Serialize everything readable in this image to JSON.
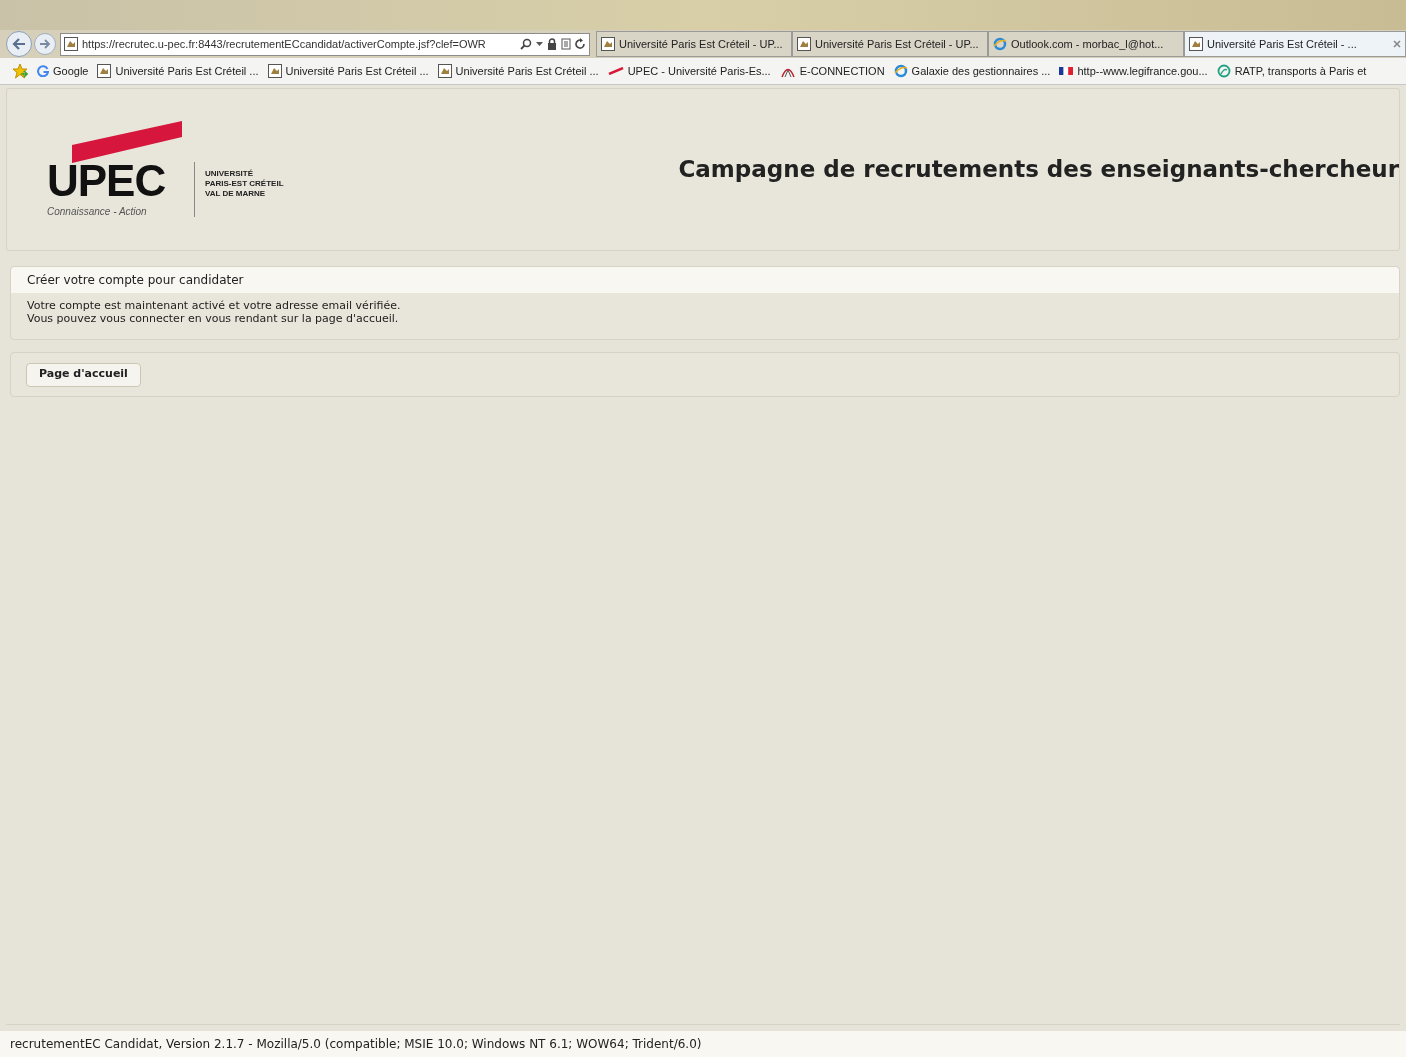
{
  "browser": {
    "url": "https://recrutec.u-pec.fr:8443/recrutementECcandidat/activerCompte.jsf?clef=OWR",
    "tabs": [
      {
        "label": "Université Paris Est Créteil - UP...",
        "kind": "site",
        "selected": false
      },
      {
        "label": "Université Paris Est Créteil - UP...",
        "kind": "site",
        "selected": false
      },
      {
        "label": "Outlook.com - morbac_l@hot...",
        "kind": "ie",
        "selected": false
      },
      {
        "label": "Université Paris Est Créteil - ...",
        "kind": "site",
        "selected": true
      }
    ],
    "favorites": [
      {
        "label": "Google",
        "kind": "google"
      },
      {
        "label": "Université Paris Est Créteil ...",
        "kind": "site"
      },
      {
        "label": "Université Paris Est Créteil ...",
        "kind": "site"
      },
      {
        "label": "Université Paris Est Créteil ...",
        "kind": "site"
      },
      {
        "label": "UPEC - Université Paris-Es...",
        "kind": "upec"
      },
      {
        "label": "E-CONNECTION",
        "kind": "econ"
      },
      {
        "label": "Galaxie des gestionnaires ...",
        "kind": "ie"
      },
      {
        "label": "http--www.legifrance.gou...",
        "kind": "flag"
      },
      {
        "label": "RATP, transports à Paris et",
        "kind": "ratp"
      }
    ]
  },
  "header": {
    "logo": {
      "wordmark": "UPEC",
      "tagline": "Connaissance - Action",
      "lines": [
        "UNIVERSITÉ",
        "PARIS-EST CRÉTEIL",
        "VAL DE MARNE"
      ]
    },
    "title": "Campagne de recrutements des enseignants-chercheur"
  },
  "section": {
    "title": "Créer votre compte pour candidater",
    "lines": [
      "Votre compte est maintenant activé et votre adresse email vérifiée.",
      "Vous pouvez vous connecter en vous rendant sur la page d'accueil."
    ]
  },
  "buttons": [
    "Page d'accueil"
  ],
  "footer": "recrutementEC Candidat, Version 2.1.7 - Mozilla/5.0 (compatible; MSIE 10.0; Windows NT 6.1; WOW64; Trident/6.0)"
}
